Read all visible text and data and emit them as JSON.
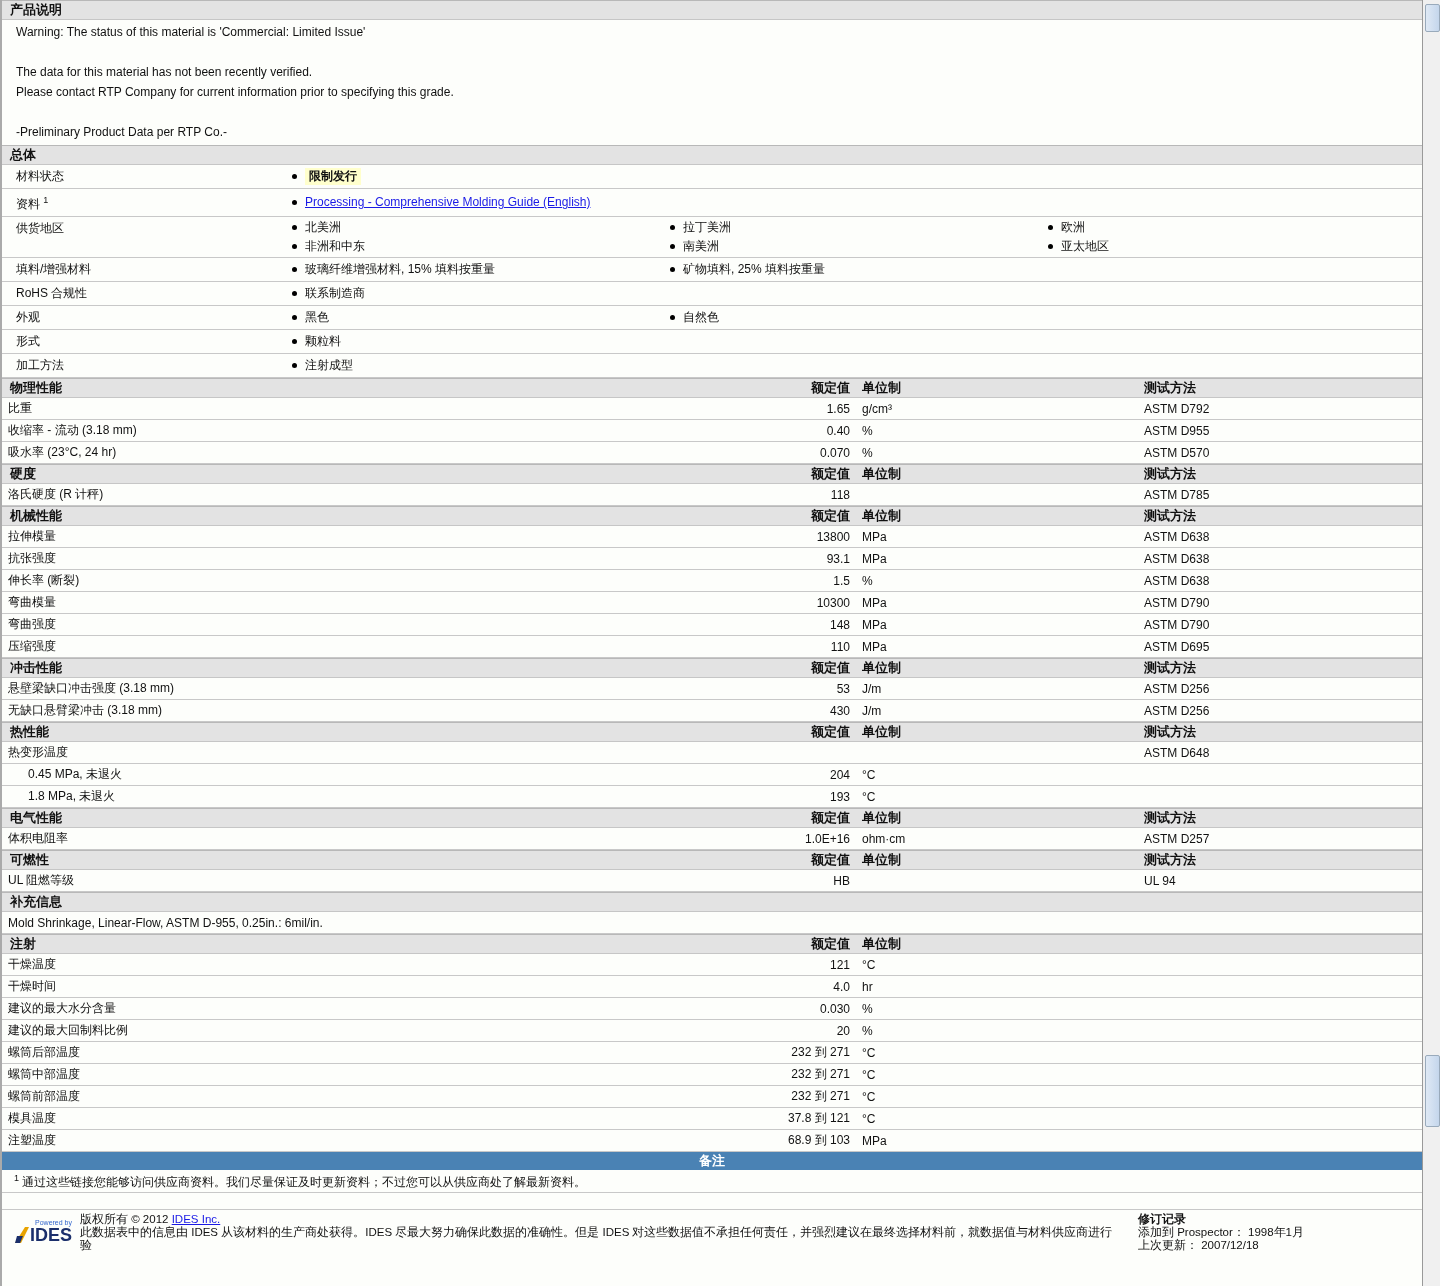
{
  "description": {
    "title": "产品说明",
    "paragraphs": [
      [
        "Warning: The status of this material is 'Commercial: Limited Issue'"
      ],
      [
        "The data for this material has not been recently verified.",
        "Please contact RTP Company for current information prior to specifying this grade."
      ],
      [
        "-Preliminary Product Data per RTP Co.-"
      ]
    ]
  },
  "general": {
    "title": "总体",
    "rows": [
      {
        "label": "材料状态",
        "kind": "highlight",
        "values": [
          "限制发行"
        ]
      },
      {
        "label": "资料 $^{1}$",
        "kind": "link",
        "values": [
          "Processing - Comprehensive Molding Guide (English)"
        ]
      },
      {
        "label": "供货地区",
        "kind": "plain",
        "values": [
          "北美洲",
          "拉丁美洲",
          "欧洲",
          "非洲和中东",
          "南美洲",
          "亚太地区"
        ]
      },
      {
        "label": "填料/增强材料",
        "kind": "plain",
        "values": [
          "玻璃纤维增强材料, 15% 填料按重量",
          "矿物填料, 25% 填料按重量"
        ]
      },
      {
        "label": "RoHS 合规性",
        "kind": "plain",
        "values": [
          "联系制造商"
        ]
      },
      {
        "label": "外观",
        "kind": "plain",
        "values": [
          "黑色",
          "自然色"
        ]
      },
      {
        "label": "形式",
        "kind": "plain",
        "values": [
          "颗粒料"
        ]
      },
      {
        "label": "加工方法",
        "kind": "plain",
        "values": [
          "注射成型"
        ]
      }
    ]
  },
  "property_sections": [
    {
      "title": "物理性能",
      "headers": [
        "额定值",
        "单位制",
        "测试方法"
      ],
      "rows": [
        {
          "name": "比重",
          "value": "1.65",
          "unit": "g/cm³",
          "method": "ASTM D792"
        },
        {
          "name": "收缩率 - 流动 (3.18 mm)",
          "value": "0.40",
          "unit": "%",
          "method": "ASTM D955"
        },
        {
          "name": "吸水率 (23°C, 24 hr)",
          "value": "0.070",
          "unit": "%",
          "method": "ASTM D570"
        }
      ]
    },
    {
      "title": "硬度",
      "headers": [
        "额定值",
        "单位制",
        "测试方法"
      ],
      "rows": [
        {
          "name": "洛氏硬度 (R 计秤)",
          "value": "118",
          "method": "ASTM D785"
        }
      ]
    },
    {
      "title": "机械性能",
      "headers": [
        "额定值",
        "单位制",
        "测试方法"
      ],
      "rows": [
        {
          "name": "拉伸模量",
          "value": "13800",
          "unit": "MPa",
          "method": "ASTM D638"
        },
        {
          "name": "抗张强度",
          "value": "93.1",
          "unit": "MPa",
          "method": "ASTM D638"
        },
        {
          "name": "伸长率 (断裂)",
          "value": "1.5",
          "unit": "%",
          "method": "ASTM D638"
        },
        {
          "name": "弯曲模量",
          "value": "10300",
          "unit": "MPa",
          "method": "ASTM D790"
        },
        {
          "name": "弯曲强度",
          "value": "148",
          "unit": "MPa",
          "method": "ASTM D790"
        },
        {
          "name": "压缩强度",
          "value": "110",
          "unit": "MPa",
          "method": "ASTM D695"
        }
      ]
    },
    {
      "title": "冲击性能",
      "headers": [
        "额定值",
        "单位制",
        "测试方法"
      ],
      "rows": [
        {
          "name": "悬壁梁缺口冲击强度 (3.18 mm)",
          "value": "53",
          "unit": "J/m",
          "method": "ASTM D256"
        },
        {
          "name": "无缺口悬臂梁冲击 (3.18 mm)",
          "value": "430",
          "unit": "J/m",
          "method": "ASTM D256"
        }
      ]
    },
    {
      "title": "热性能",
      "headers": [
        "额定值",
        "单位制",
        "测试方法"
      ],
      "rows": [
        {
          "name": "热变形温度",
          "method": "ASTM D648",
          "children": [
            {
              "name": "0.45 MPa, 未退火",
              "value": "204",
              "unit": "°C"
            },
            {
              "name": "1.8 MPa, 未退火",
              "value": "193",
              "unit": "°C"
            }
          ]
        }
      ]
    },
    {
      "title": "电气性能",
      "headers": [
        "额定值",
        "单位制",
        "测试方法"
      ],
      "rows": [
        {
          "name": "体积电阻率",
          "value": "1.0E+16",
          "unit": "ohm·cm",
          "method": "ASTM D257"
        }
      ]
    },
    {
      "title": "可燃性",
      "headers": [
        "额定值",
        "单位制",
        "测试方法"
      ],
      "rows": [
        {
          "name": "UL 阻燃等级",
          "value": "HB",
          "method": "UL 94"
        }
      ]
    }
  ],
  "supplementary": {
    "title": "补充信息",
    "text": "Mold Shrinkage, Linear-Flow, ASTM D-955, 0.25in.: 6mil/in."
  },
  "injection": {
    "title": "注射",
    "headers": [
      "额定值",
      "单位制"
    ],
    "rows": [
      {
        "name": "干燥温度",
        "value": "121",
        "unit": "°C"
      },
      {
        "name": "干燥时间",
        "value": "4.0",
        "unit": "hr"
      },
      {
        "name": "建议的最大水分含量",
        "value": "0.030",
        "unit": "%"
      },
      {
        "name": "建议的最大回制料比例",
        "value": "20",
        "unit": "%"
      },
      {
        "name": "螺筒后部温度",
        "value": "232 到 271",
        "unit": "°C"
      },
      {
        "name": "螺筒中部温度",
        "value": "232 到 271",
        "unit": "°C"
      },
      {
        "name": "螺筒前部温度",
        "value": "232 到 271",
        "unit": "°C"
      },
      {
        "name": "模具温度",
        "value": "37.8 到 121",
        "unit": "°C"
      },
      {
        "name": "注塑温度",
        "value": "68.9 到 103",
        "unit": "MPa"
      }
    ]
  },
  "notes": {
    "title": "备注",
    "footnote": "$^{1}$ 通过这些链接您能够访问供应商资料。我们尽量保证及时更新资料；不过您可以从供应商处了解最新资料。"
  },
  "footer": {
    "logo_caption": "Powered by",
    "logo_text": "IDES",
    "copyright": "版权所有 © 2012",
    "copyright_link": "IDES Inc.",
    "disclaimer": "此数据表中的信息由 IDES 从该材料的生产商处获得。IDES 尽最大努力确保此数据的准确性。但是 IDES 对这些数据值不承担任何责任，并强烈建议在最终选择材料前，就数据值与材料供应商进行验",
    "revision_title": "修订记录",
    "revision_lines": [
      "添加到 Prospector： 1998年1月",
      "上次更新： 2007/12/18"
    ]
  }
}
